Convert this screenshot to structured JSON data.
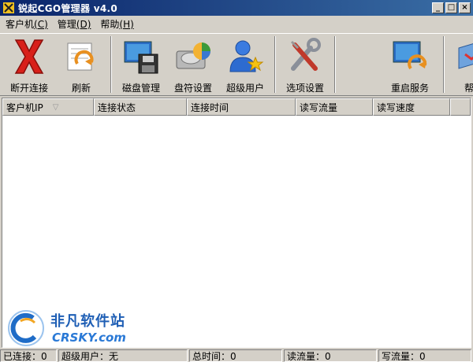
{
  "window": {
    "title": "锐起CGO管理器 v4.0",
    "minimize": "_",
    "maximize": "□",
    "close": "×"
  },
  "menu": [
    {
      "label": "客户机",
      "accel": "(C)"
    },
    {
      "label": "管理",
      "accel": "(D)"
    },
    {
      "label": "帮助",
      "accel": "(H)"
    }
  ],
  "toolbar": {
    "disconnect": "断开连接",
    "refresh": "刷新",
    "disk_manage": "磁盘管理",
    "drive_setting": "盘符设置",
    "super_user": "超级用户",
    "options": "选项设置",
    "restart_service": "重启服务",
    "help": "帮助"
  },
  "table": {
    "columns": [
      "客户机IP",
      "连接状态",
      "连接时间",
      "读写流量",
      "读写速度"
    ],
    "rows": []
  },
  "watermark": {
    "site": "非凡软件站",
    "url": "CRSKY.com"
  },
  "status": {
    "connected": "已连接：0",
    "super_user": "超级用户：无",
    "total_time": "总时间：0",
    "read_flow": "读流量：0",
    "write_flow": "写流量：0"
  }
}
